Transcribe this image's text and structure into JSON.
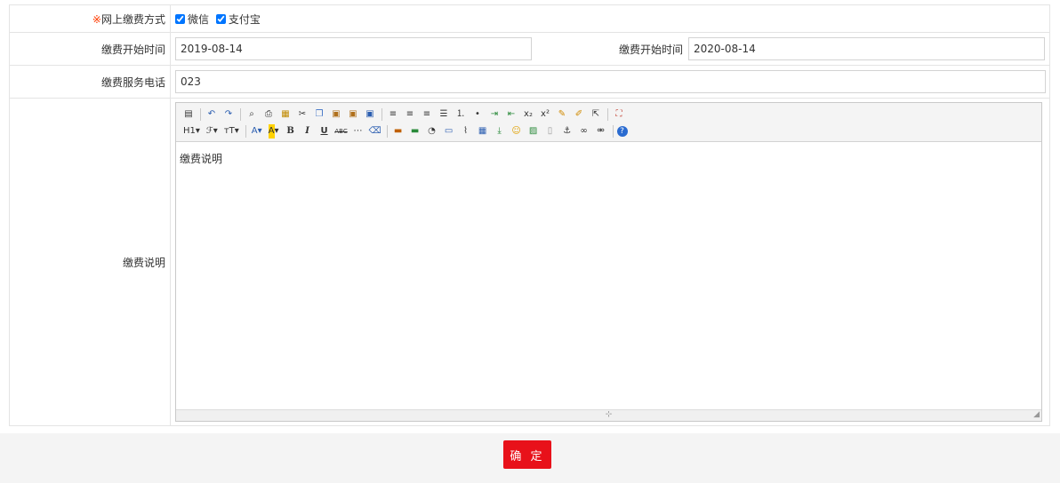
{
  "form": {
    "payment_method": {
      "required_mark": "※",
      "label": "网上缴费方式",
      "options": [
        {
          "label": "微信",
          "checked": true
        },
        {
          "label": "支付宝",
          "checked": true
        }
      ]
    },
    "start_time": {
      "label": "缴费开始时间",
      "value": "2019-08-14"
    },
    "end_time": {
      "label": "缴费开始时间",
      "value": "2020-08-14"
    },
    "phone": {
      "label": "缴费服务电话",
      "value": "023"
    },
    "description": {
      "label": "缴费说明",
      "content": "缴费说明"
    }
  },
  "editor": {
    "heading_label": "H1",
    "font_family_label": "ℱ",
    "font_size_label": "тT",
    "font_color_label": "A",
    "bg_color_label": "A",
    "bold_label": "B",
    "italic_label": "I",
    "underline_label": "U",
    "strike_label": "ABC",
    "resize_grip": "⊹"
  },
  "actions": {
    "confirm_label": "确 定"
  },
  "colors": {
    "accent": "#e8111a",
    "required": "#ff3b00"
  }
}
